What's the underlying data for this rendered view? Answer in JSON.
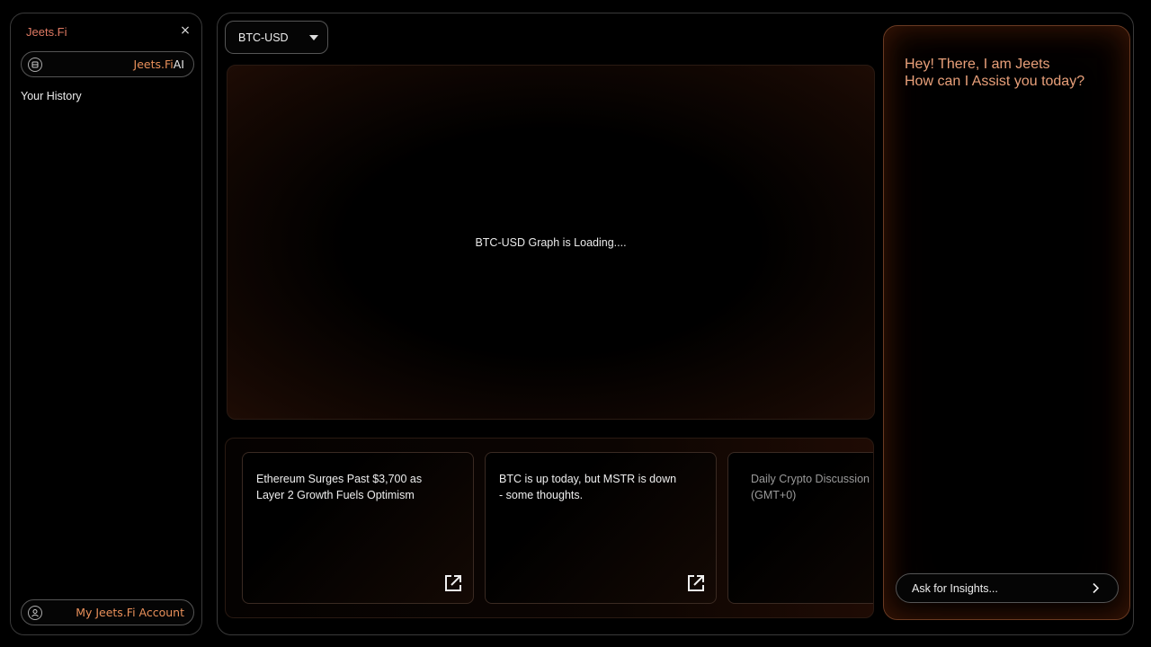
{
  "sidebar": {
    "brand": "Jeets.Fi",
    "close_label": "×",
    "ai_button": {
      "part1": "Jeets.Fi",
      "part2": " AI"
    },
    "history_title": "Your History",
    "account_button": "My Jeets.Fi Account"
  },
  "main": {
    "pair_select": {
      "value": "BTC-USD"
    },
    "graph": {
      "status": "BTC-USD Graph is Loading...."
    },
    "news": [
      {
        "title": "Ethereum Surges Past $3,700 as Layer 2 Growth Fuels Optimism"
      },
      {
        "title": "BTC is up today, but MSTR is down - some thoughts."
      },
      {
        "title": "Daily Crypto Discussion (GMT+0)"
      }
    ]
  },
  "chat": {
    "greeting_line1": "Hey! There, I am Jeets",
    "greeting_line2": "How can I Assist you today?",
    "input_placeholder": "Ask for Insights..."
  },
  "colors": {
    "accent": "#e9905a",
    "brand": "#e07a63",
    "background": "#000000"
  }
}
